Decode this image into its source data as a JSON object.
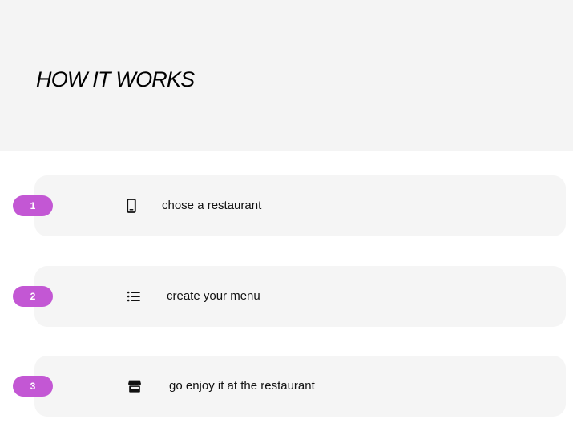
{
  "header": {
    "title": "HOW IT WORKS"
  },
  "colors": {
    "hero_background": "#f4f4f4",
    "card_background": "#f5f5f5",
    "badge_background": "#c357d4",
    "badge_text": "#ffffff",
    "text": "#111111"
  },
  "steps": [
    {
      "number": "1",
      "icon": "mobile-phone-icon",
      "text": "chose a restaurant"
    },
    {
      "number": "2",
      "icon": "list-icon",
      "text": "create your menu"
    },
    {
      "number": "3",
      "icon": "store-icon",
      "text": "go enjoy it at the restaurant"
    }
  ]
}
